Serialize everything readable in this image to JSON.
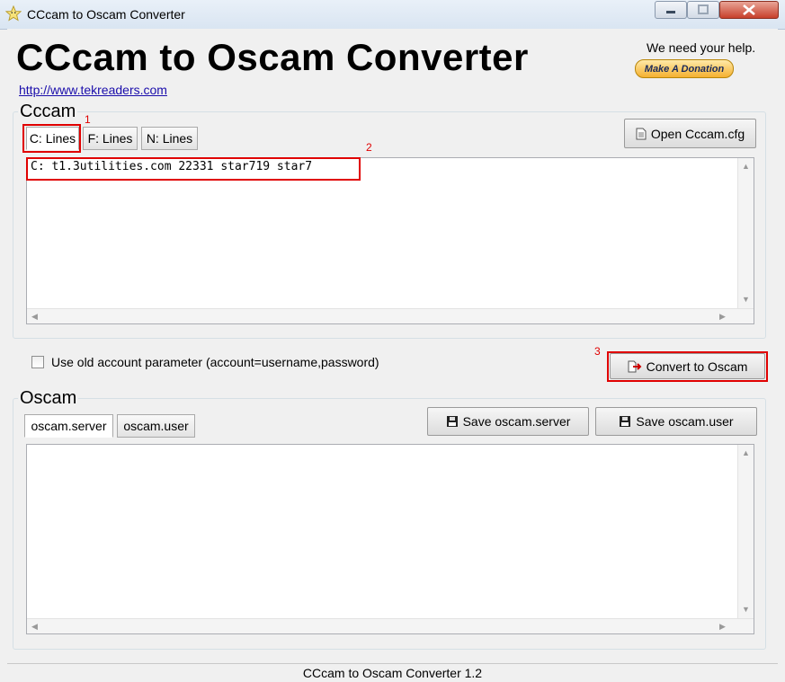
{
  "window": {
    "title": "CCcam to Oscam Converter"
  },
  "header": {
    "app_title": "CCcam to Oscam Converter",
    "website_link": "http://www.tekreaders.com",
    "help_text": "We need your help.",
    "donate_label": "Make A Donation"
  },
  "cccam": {
    "group_label": "Cccam",
    "tabs": [
      {
        "label": "C: Lines",
        "active": true
      },
      {
        "label": "F: Lines",
        "active": false
      },
      {
        "label": "N: Lines",
        "active": false
      }
    ],
    "open_button_label": "Open Cccam.cfg",
    "textarea_value": "C: t1.3utilities.com 22331 star719 star7"
  },
  "options": {
    "old_account_checkbox_label": "Use old account parameter (account=username,password)",
    "old_account_checked": false,
    "convert_button_label": "Convert to Oscam"
  },
  "oscam": {
    "group_label": "Oscam",
    "tabs": [
      {
        "label": "oscam.server",
        "active": true
      },
      {
        "label": "oscam.user",
        "active": false
      }
    ],
    "save_server_label": "Save oscam.server",
    "save_user_label": "Save oscam.user",
    "textarea_value": ""
  },
  "annotations": {
    "marker_1": "1",
    "marker_2": "2",
    "marker_3": "3",
    "color": "#e00000"
  },
  "status": {
    "text": "CCcam to Oscam Converter  1.2"
  },
  "icons": {
    "app": "star-icon",
    "open": "document-icon",
    "convert": "document-arrow-icon",
    "save": "floppy-disk-icon"
  }
}
